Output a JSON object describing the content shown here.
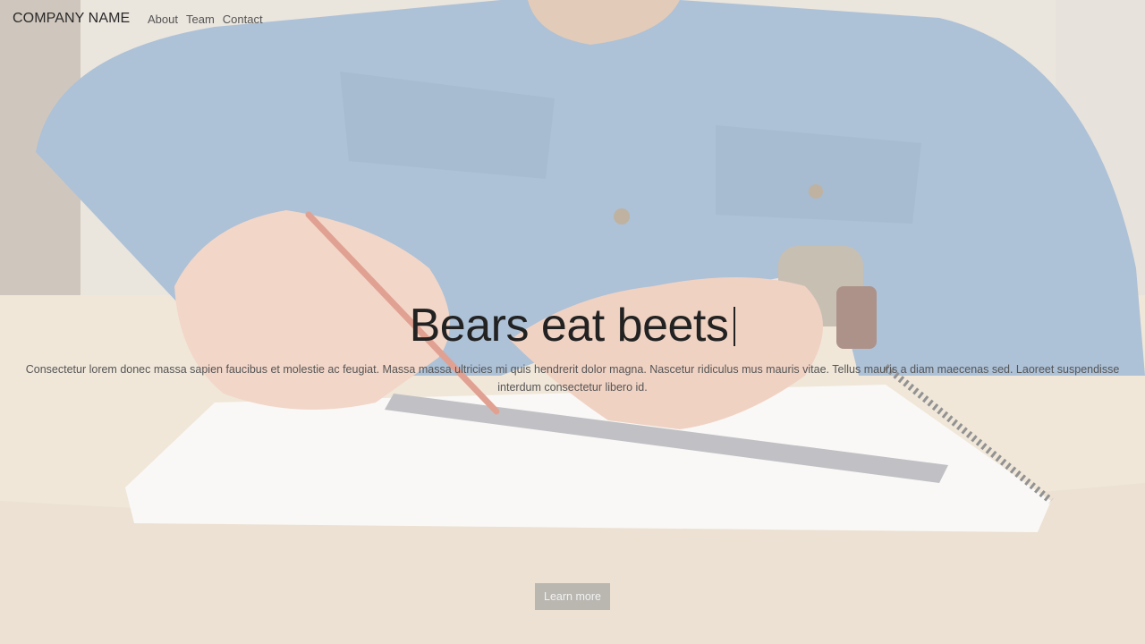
{
  "nav": {
    "brand": "COMPANY NAME",
    "links": [
      "About",
      "Team",
      "Contact"
    ]
  },
  "hero": {
    "headline": "Bears eat beets",
    "lead": "Consectetur lorem donec massa sapien faucibus et molestie ac feugiat. Massa massa ultricies mi quis hendrerit dolor magna. Nascetur ridiculus mus mauris vitae. Tellus mauris a diam maecenas sed. Laoreet suspendisse interdum consectetur libero id.",
    "cta_label": "Learn more"
  }
}
